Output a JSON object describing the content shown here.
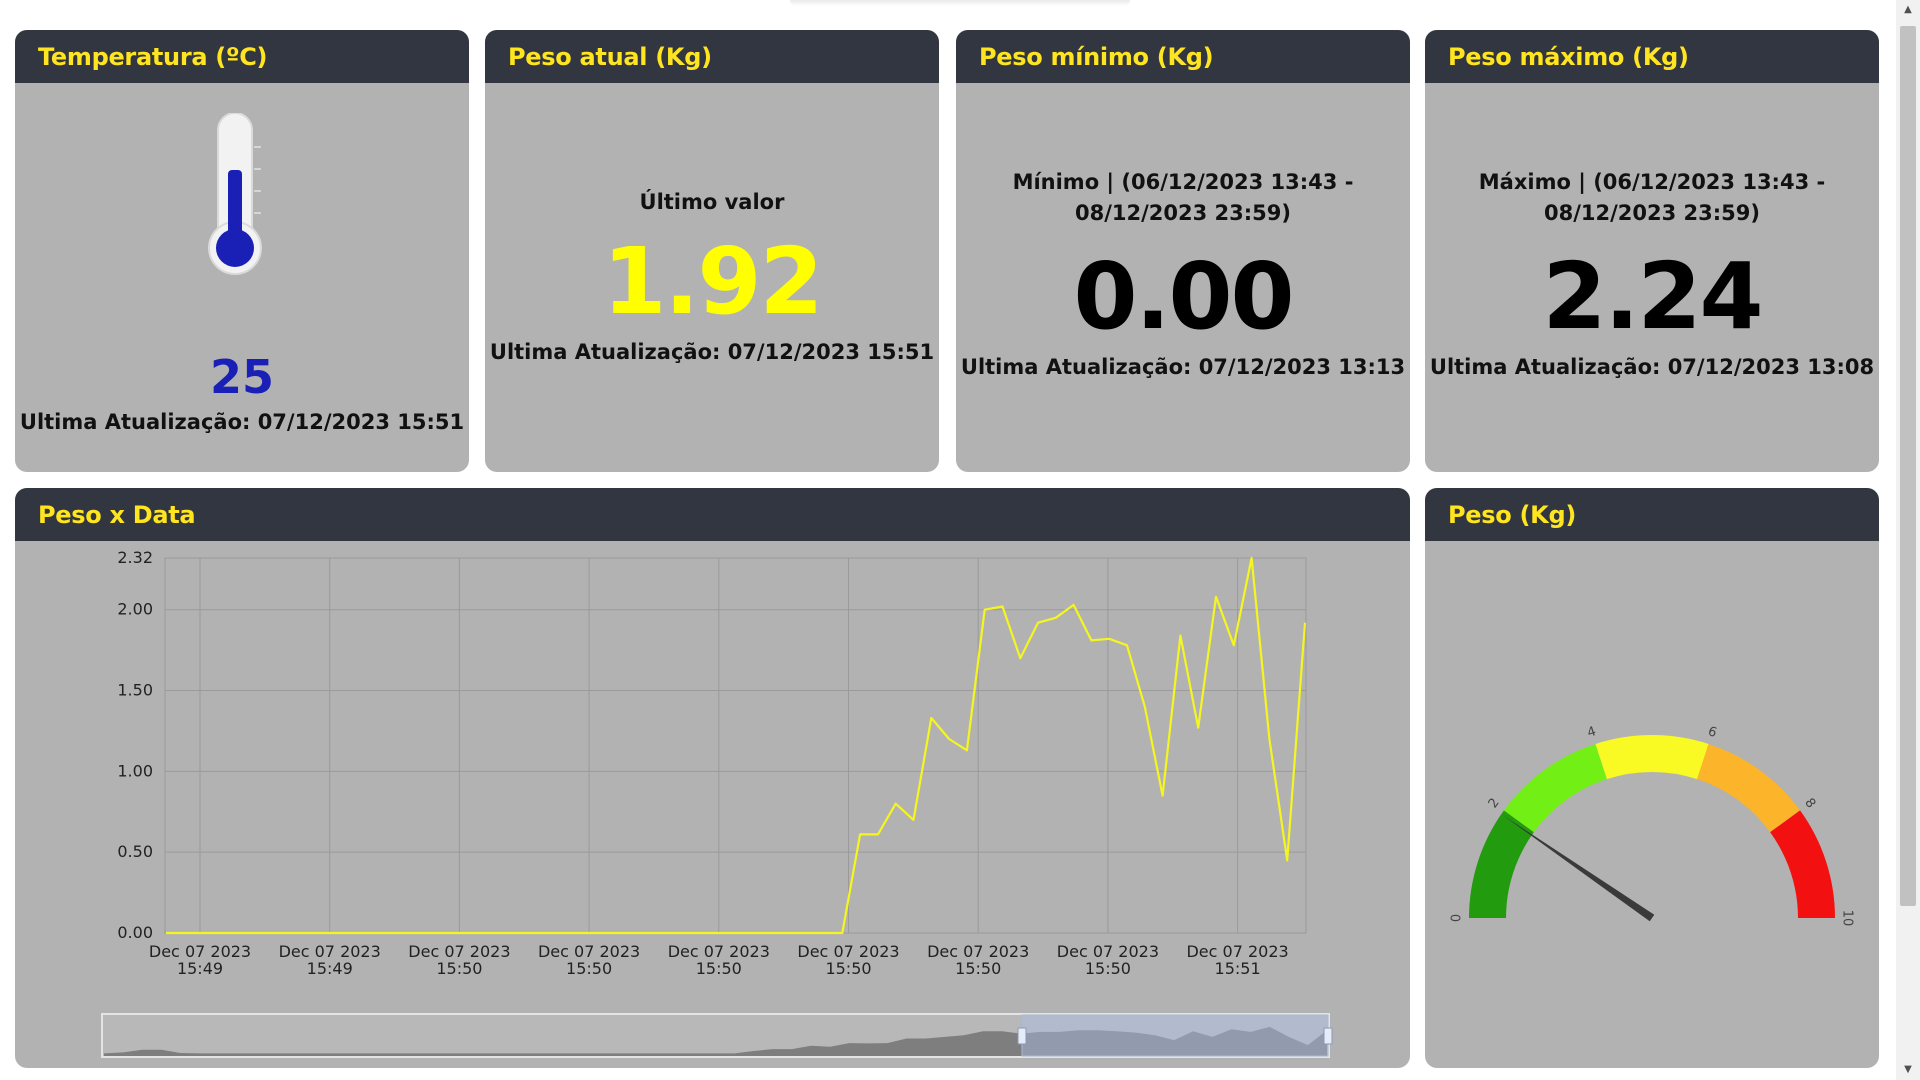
{
  "temperature_card": {
    "title": "Temperatura (ºC)",
    "value": "25",
    "last_update": "Ultima Atualização: 07/12/2023 15:51"
  },
  "current_weight_card": {
    "title": "Peso atual (Kg)",
    "label": "Último valor",
    "value": "1.92",
    "last_update": "Ultima Atualização: 07/12/2023 15:51"
  },
  "min_weight_card": {
    "title": "Peso mínimo (Kg)",
    "label": "Mínimo | (06/12/2023 13:43 - 08/12/2023 23:59)",
    "value": "0.00",
    "last_update": "Ultima Atualização: 07/12/2023 13:13"
  },
  "max_weight_card": {
    "title": "Peso máximo (Kg)",
    "label": "Máximo | (06/12/2023 13:43 - 08/12/2023 23:59)",
    "value": "2.24",
    "last_update": "Ultima Atualização: 07/12/2023 13:08"
  },
  "chart_card": {
    "title": "Peso x Data"
  },
  "gauge_card": {
    "title": "Peso (Kg)"
  },
  "colors": {
    "header_bg": "#323640",
    "title_yellow": "#ffe51f",
    "card_bg": "#b2b2b2",
    "value_yellow": "#ffff00",
    "temp_blue": "#1a1fb6",
    "line": "#f5f520"
  },
  "icons": [
    "thermometer-icon",
    "scroll-up-arrow-icon",
    "scroll-down-arrow-icon"
  ],
  "chart_data": [
    {
      "type": "line",
      "title": "",
      "xlabel": "",
      "ylabel": "",
      "ylim": [
        0,
        2.32
      ],
      "yticks": [
        "0.00",
        "0.50",
        "1.00",
        "1.50",
        "2.00",
        "2.32"
      ],
      "xticks": [
        [
          "Dec 07 2023",
          "15:49"
        ],
        [
          "Dec 07 2023",
          "15:49"
        ],
        [
          "Dec 07 2023",
          "15:50"
        ],
        [
          "Dec 07 2023",
          "15:50"
        ],
        [
          "Dec 07 2023",
          "15:50"
        ],
        [
          "Dec 07 2023",
          "15:50"
        ],
        [
          "Dec 07 2023",
          "15:50"
        ],
        [
          "Dec 07 2023",
          "15:50"
        ],
        [
          "Dec 07 2023",
          "15:51"
        ]
      ],
      "grid": true,
      "series": [
        {
          "x": [
            0,
            1,
            2,
            3,
            4,
            5,
            6,
            7,
            8,
            9,
            10,
            11,
            12,
            13,
            14,
            15,
            16,
            17,
            18,
            19,
            20,
            21,
            22,
            23,
            24,
            25,
            26,
            27,
            28,
            29,
            30,
            31,
            32,
            33,
            34,
            35,
            36,
            37,
            38,
            39,
            40,
            41,
            42,
            43,
            44,
            45,
            46,
            47,
            48,
            49,
            50,
            51,
            52,
            53,
            54,
            55,
            56,
            57,
            58,
            59,
            60,
            61,
            62,
            63,
            64
          ],
          "y": [
            0,
            0,
            0,
            0,
            0,
            0,
            0,
            0,
            0,
            0,
            0,
            0,
            0,
            0,
            0,
            0,
            0,
            0,
            0,
            0,
            0,
            0,
            0,
            0,
            0,
            0,
            0,
            0,
            0,
            0,
            0,
            0,
            0,
            0,
            0,
            0,
            0,
            0,
            0,
            0.61,
            0.61,
            0.8,
            0.7,
            1.33,
            1.2,
            1.13,
            2.0,
            2.02,
            1.7,
            1.92,
            1.95,
            2.03,
            1.81,
            1.82,
            1.78,
            1.4,
            0.85,
            1.84,
            1.27,
            2.08,
            1.78,
            2.32,
            1.2,
            0.45,
            1.92
          ]
        }
      ]
    },
    {
      "type": "gauge",
      "min": 0,
      "max": 10,
      "tick_labels": [
        "0",
        "2",
        "4",
        "6",
        "8",
        "10"
      ],
      "bands": [
        {
          "from": 0,
          "to": 2,
          "color": "#229b0f"
        },
        {
          "from": 2,
          "to": 4,
          "color": "#72ef14"
        },
        {
          "from": 4,
          "to": 6,
          "color": "#f9fa23"
        },
        {
          "from": 6,
          "to": 8,
          "color": "#fcb42a"
        },
        {
          "from": 8,
          "to": 10,
          "color": "#f21010"
        }
      ],
      "value": 1.92
    }
  ]
}
